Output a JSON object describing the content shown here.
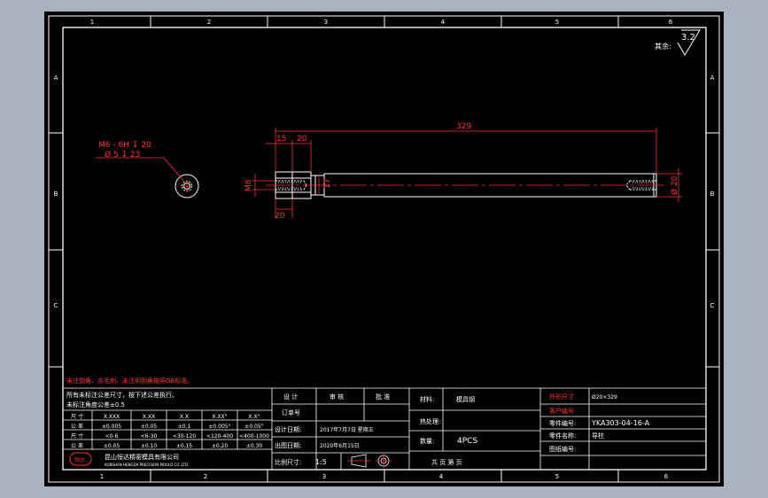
{
  "frame": {
    "top_cols": [
      "1",
      "2",
      "3",
      "4",
      "5",
      "6"
    ],
    "bottom_cols": [
      "1",
      "2",
      "3",
      "4",
      "5",
      "6"
    ],
    "rows": [
      "A",
      "B",
      "C",
      "D"
    ]
  },
  "roughness": {
    "label": "其余:",
    "value": "3.2"
  },
  "dims": {
    "thread_note_1": "M6 - 6H ↧ 20",
    "thread_note_2": "Ø 5 ↧ 23",
    "overall_length": "329",
    "d15": "15",
    "d20": "20",
    "d20_lower": "20",
    "m8": "M8",
    "d17": "17",
    "dia20": "Ø 20"
  },
  "notes": {
    "red_note": "未注倒角、去毛刺、未注明倒角按照GB标准。",
    "tol_title_1": "所有未标注公差尺寸，按下述公差执行。",
    "tol_title_2": "未标注角度公差±0.5"
  },
  "tol_table": {
    "headers": [
      "尺 寸",
      "X.XXX",
      "X.XX",
      "X.X",
      "X.XX°",
      "X.X°"
    ],
    "rows": [
      [
        "公 差",
        "±0.005",
        "±0.05",
        "±0.1",
        "±0.005°",
        "±0.05°"
      ],
      [
        "尺 寸",
        "<0-6",
        "<6-30",
        "<30-120",
        "<120-400",
        "<400-1000"
      ],
      [
        "公 差",
        "±0.05",
        "±0.10",
        "±0.15",
        "±0.20",
        "±0.30"
      ]
    ]
  },
  "company": {
    "logo": "恒达",
    "name": "昆山恒达精密模具有限公司",
    "sub": "KUNSHAN HENGDA PRECISION MOULD CO.,LTD"
  },
  "title_block": {
    "design": "设 计",
    "review": "审 核",
    "approve": "批 准",
    "ref_no": "订单号",
    "design_date_label": "设计日期:",
    "design_date_value": "2017年7月7日 星期五",
    "out_date_label": "出图日期:",
    "out_date_value": "2020年6月15日",
    "scale_label": "比例尺寸:",
    "scale_value": "1:5",
    "material_label": "材料:",
    "material_value": "模具钢",
    "heat_label": "热处理:",
    "qty_label": "数量:",
    "qty_value": "4PCS",
    "sheet_label": "共 页  第 页",
    "part_size_label": "外形尺寸:",
    "part_size_value": "Ø20×329",
    "custom_label": "客户编号:",
    "part_no_label": "零件编号:",
    "part_no_value": "YKA303-04-16-A",
    "part_name_label": "零件名称:",
    "part_name_value": "导柱",
    "drawing_no_label": "图纸编号:"
  }
}
